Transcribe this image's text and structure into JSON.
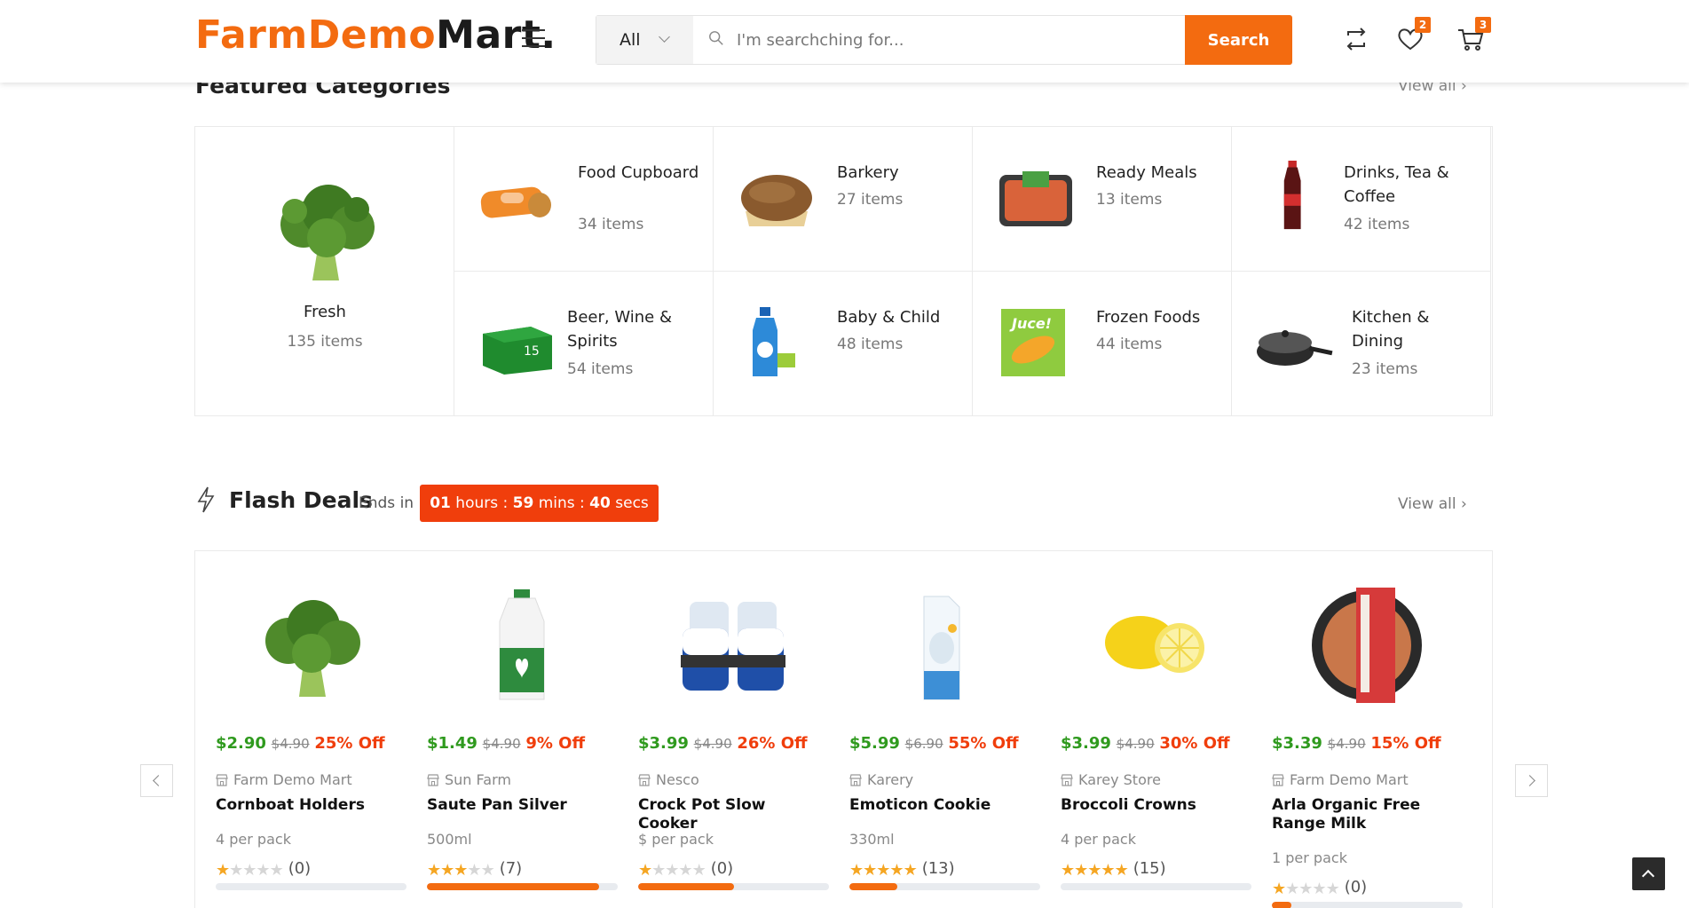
{
  "header": {
    "logo_brand": "FarmDemo",
    "logo_suffix": "Mart.",
    "search": {
      "category": "All",
      "placeholder": "I'm searchching for...",
      "button": "Search"
    },
    "wishlist_count": "2",
    "cart_count": "3"
  },
  "featured": {
    "title": "Featured Categories",
    "view_all": "View all",
    "fresh": {
      "name": "Fresh",
      "count": "135 items"
    },
    "categories": [
      {
        "name": "Food Cupboard",
        "count": "34 items"
      },
      {
        "name": "Barkery",
        "count": "27 items"
      },
      {
        "name": "Ready Meals",
        "count": "13 items"
      },
      {
        "name": "Drinks, Tea & Coffee",
        "count": "42 items"
      },
      {
        "name": "Beer, Wine & Spirits",
        "count": "54 items"
      },
      {
        "name": "Baby & Child",
        "count": "48 items"
      },
      {
        "name": "Frozen Foods",
        "count": "44 items"
      },
      {
        "name": "Kitchen & Dining",
        "count": "23 items"
      }
    ]
  },
  "flash": {
    "title": "Flash Deals",
    "ends_in": "Ends in :",
    "timer": {
      "hours": "01",
      "hours_label": "hours :",
      "mins": "59",
      "mins_label": "mins :",
      "secs": "40",
      "secs_label": "secs"
    },
    "view_all": "View all"
  },
  "products": [
    {
      "price": "$2.90",
      "old_price": "$4.90",
      "discount": "25% Off",
      "store": "Farm Demo Mart",
      "name": "Cornboat Holders",
      "unit": "4 per pack",
      "stars": 1,
      "reviews": "(0)",
      "sold_fraction": 0
    },
    {
      "price": "$1.49",
      "old_price": "$4.90",
      "discount": "9% Off",
      "store": "Sun Farm",
      "name": "Saute Pan Silver",
      "unit": "500ml",
      "stars": 3,
      "reviews": "(7)",
      "sold_fraction": 0.9
    },
    {
      "price": "$3.99",
      "old_price": "$4.90",
      "discount": "26% Off",
      "store": "Nesco",
      "name": "Crock Pot Slow Cooker",
      "unit": "$ per pack",
      "stars": 1,
      "reviews": "(0)",
      "sold_fraction": 0.5
    },
    {
      "price": "$5.99",
      "old_price": "$6.90",
      "discount": "55% Off",
      "store": "Karery",
      "name": "Emoticon Cookie",
      "unit": "330ml",
      "stars": 5,
      "reviews": "(13)",
      "sold_fraction": 0.25
    },
    {
      "price": "$3.99",
      "old_price": "$4.90",
      "discount": "30% Off",
      "store": "Karey Store",
      "name": "Broccoli Crowns",
      "unit": "4 per pack",
      "stars": 5,
      "reviews": "(15)",
      "sold_fraction": 0
    },
    {
      "price": "$3.39",
      "old_price": "$4.90",
      "discount": "15% Off",
      "store": "Farm Demo Mart",
      "name": "Arla Organic Free Range Milk",
      "unit": "1 per pack",
      "stars": 1,
      "reviews": "(0)",
      "sold_fraction": 0.1
    }
  ],
  "colors": {
    "accent": "#f36b10",
    "price": "#2f9a1e",
    "discount": "#f03e0c",
    "star": "#f5a623"
  },
  "icons": [
    "menu-icon",
    "chevron-down-icon",
    "search-icon",
    "compare-icon",
    "heart-icon",
    "cart-icon",
    "lightning-icon",
    "store-icon",
    "star-icon",
    "chevron-left-icon",
    "chevron-right-icon",
    "arrow-up-icon"
  ]
}
